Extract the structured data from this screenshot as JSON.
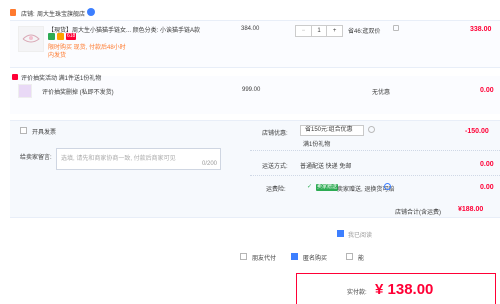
{
  "shop": {
    "label": "店铺:",
    "name": "周大生珠宝旗舰店"
  },
  "product": {
    "title_line1": "【現货】周大生小猫猫手链女... 颜色分类: 小诶猫手链A款",
    "tag_a": "",
    "tag_b": "",
    "tag_c": "618",
    "promo": "限时购买 现货, 付款后48小时",
    "promo2": "内发货",
    "price": "384.00",
    "qty": "1",
    "minus": "−",
    "plus": "+",
    "discount": "省46:逛双价",
    "subtotal": "338.00"
  },
  "gift": {
    "header": "评价抽奖活动 满1件送1份礼物",
    "name": "评价抽奖删掉 (私即不发货)",
    "price": "999.00",
    "shipping": "无优惠",
    "subtotal": "0.00"
  },
  "options": {
    "invoice_label": "开具发票",
    "message_label": "给卖家留言:",
    "message_placeholder": "选填, 请先和商家协商一致, 付款后商家可见",
    "message_count": "0/200",
    "shop_discount_label": "店铺优惠:",
    "shop_discount_value": "省150元:组合优惠",
    "shop_discount_sub": "满1份礼物",
    "shop_discount_amount": "-150.00",
    "shipping_label": "运送方式:",
    "shipping_value": "普通配送 快递 免邮",
    "shipping_amount": "0.00",
    "insurance_label": "运费险:",
    "insurance_badge": "卖家赠送",
    "insurance_text": "卖家赠送, 退换货可赔",
    "insurance_amount": "0.00"
  },
  "total": {
    "label": "店铺合计(含运费)",
    "amount": "¥188.00"
  },
  "bottom": {
    "agree_label": "我已阅读",
    "anon_label": "匿名购买",
    "pay_for_label": "朋友代付",
    "extra_label": "能",
    "paid_label": "实付款:",
    "paid_amount": "¥ 138.00"
  },
  "colors": {
    "accent": "#ff0036",
    "blue": "#3d7fff",
    "green": "#2dab53"
  }
}
